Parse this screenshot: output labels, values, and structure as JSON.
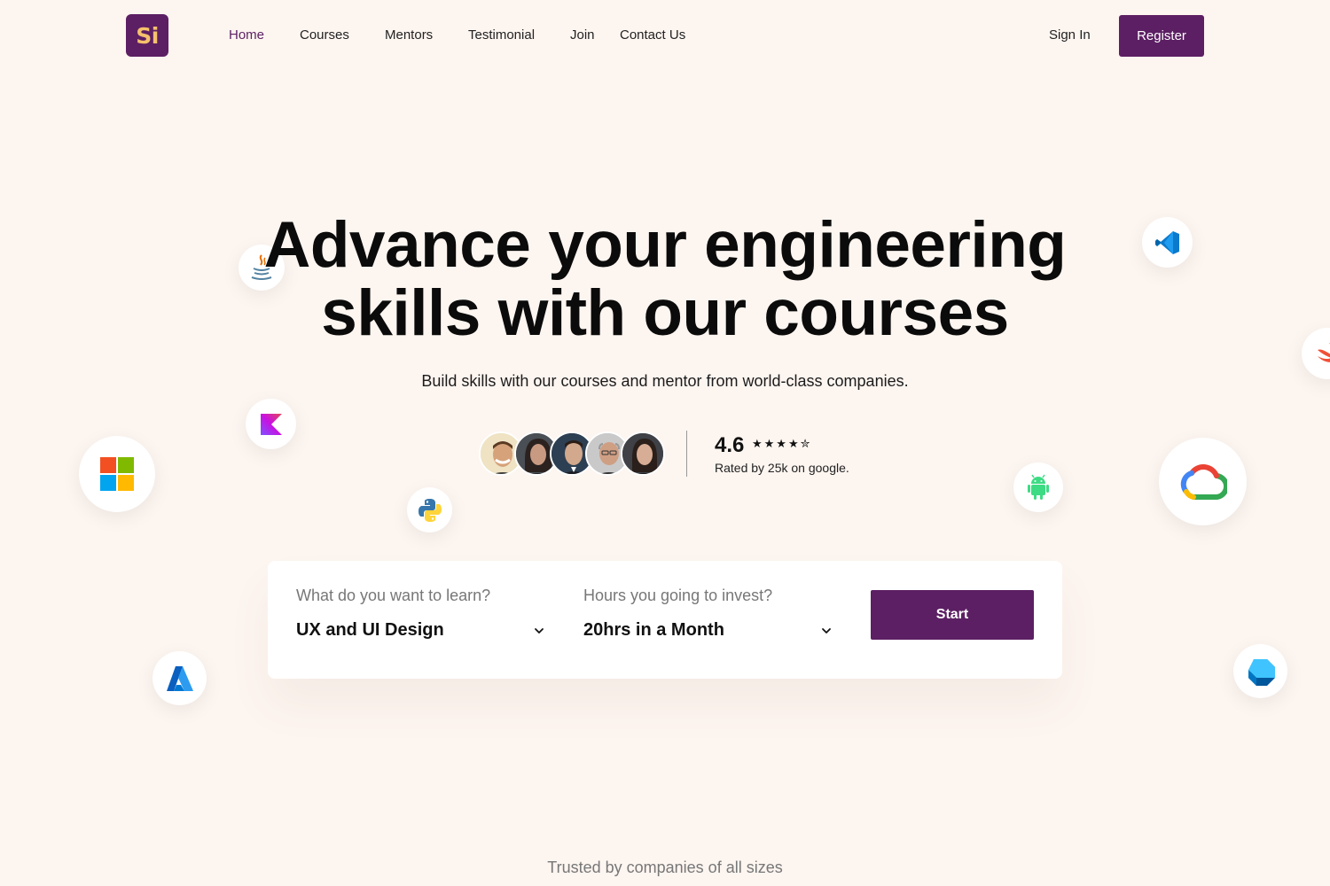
{
  "brand": {
    "logo_text": "Si",
    "accent": "#5c1f63",
    "logo_text_color": "#f5c16c",
    "background": "#fdf5f0"
  },
  "nav": {
    "items": [
      {
        "label": "Home",
        "active": true
      },
      {
        "label": "Courses"
      },
      {
        "label": "Mentors"
      },
      {
        "label": "Testimonial"
      },
      {
        "label": "Join"
      },
      {
        "label": "Contact Us"
      }
    ],
    "signin_label": "Sign In",
    "register_label": "Register"
  },
  "hero": {
    "headline_line1": "Advance your engineering",
    "headline_line2": "skills with our courses",
    "subheadline": "Build skills with our courses and mentor from world-class companies."
  },
  "rating": {
    "value": "4.6",
    "stars_text": "★★★★✮",
    "stars_value": 4.6,
    "subtext": "Rated by 25k on google.",
    "avatars": [
      "mentor-avatar",
      "mentor-avatar",
      "mentor-avatar",
      "mentor-avatar",
      "mentor-avatar"
    ]
  },
  "tech_icons": [
    "java-icon",
    "vscode-icon",
    "swift-icon",
    "kotlin-icon",
    "microsoft-icon",
    "python-icon",
    "android-icon",
    "google-cloud-icon",
    "azure-icon",
    "dart-icon"
  ],
  "search": {
    "learn_label": "What do you want to learn?",
    "learn_value": "UX and UI Design",
    "hours_label": "Hours you going to invest?",
    "hours_value": "20hrs in a Month",
    "start_label": "Start"
  },
  "footer": {
    "trusted_text": "Trusted by companies of all sizes"
  }
}
